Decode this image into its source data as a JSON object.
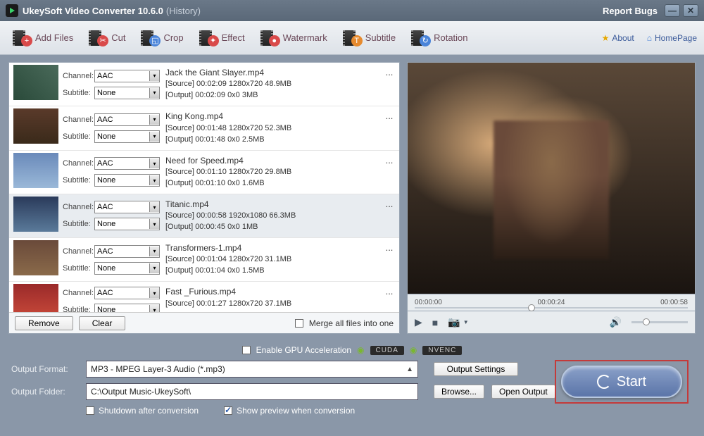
{
  "title": {
    "app": "UkeySoft Video Converter 10.6.0",
    "history": "(History)",
    "report": "Report Bugs"
  },
  "toolbar": {
    "addFiles": "Add Files",
    "cut": "Cut",
    "crop": "Crop",
    "effect": "Effect",
    "watermark": "Watermark",
    "subtitle": "Subtitle",
    "rotation": "Rotation",
    "about": "About",
    "homepage": "HomePage"
  },
  "files": [
    {
      "name": "Jack the Giant Slayer.mp4",
      "channel": "AAC",
      "subtitle": "None",
      "source": "[Source]  00:02:09  1280x720  48.9MB",
      "output": "[Output]  00:02:09  0x0  3MB"
    },
    {
      "name": "King Kong.mp4",
      "channel": "AAC",
      "subtitle": "None",
      "source": "[Source]  00:01:48  1280x720  52.3MB",
      "output": "[Output]  00:01:48  0x0  2.5MB"
    },
    {
      "name": "Need for Speed.mp4",
      "channel": "AAC",
      "subtitle": "None",
      "source": "[Source]  00:01:10  1280x720  29.8MB",
      "output": "[Output]  00:01:10  0x0  1.6MB"
    },
    {
      "name": "Titanic.mp4",
      "channel": "AAC",
      "subtitle": "None",
      "source": "[Source]  00:00:58  1920x1080  66.3MB",
      "output": "[Output]  00:00:45  0x0  1MB"
    },
    {
      "name": "Transformers-1.mp4",
      "channel": "AAC",
      "subtitle": "None",
      "source": "[Source]  00:01:04  1280x720  31.1MB",
      "output": "[Output]  00:01:04  0x0  1.5MB"
    },
    {
      "name": "Fast _Furious.mp4",
      "channel": "AAC",
      "subtitle": "None",
      "source": "[Source]  00:01:27  1280x720  37.1MB",
      "output": ""
    }
  ],
  "listActions": {
    "remove": "Remove",
    "clear": "Clear",
    "merge": "Merge all files into one"
  },
  "labels": {
    "channel": "Channel:",
    "subtitle": "Subtitle:"
  },
  "player": {
    "t0": "00:00:00",
    "t1": "00:00:24",
    "t2": "00:00:58"
  },
  "gpu": {
    "enable": "Enable GPU Acceleration",
    "cuda": "CUDA",
    "nvenc": "NVENC"
  },
  "output": {
    "formatLabel": "Output Format:",
    "format": "MP3 - MPEG Layer-3 Audio (*.mp3)",
    "folderLabel": "Output Folder:",
    "folder": "C:\\Output Music-UkeySoft\\",
    "settings": "Output Settings",
    "browse": "Browse...",
    "open": "Open Output",
    "shutdown": "Shutdown after conversion",
    "preview": "Show preview when conversion",
    "start": "Start"
  }
}
